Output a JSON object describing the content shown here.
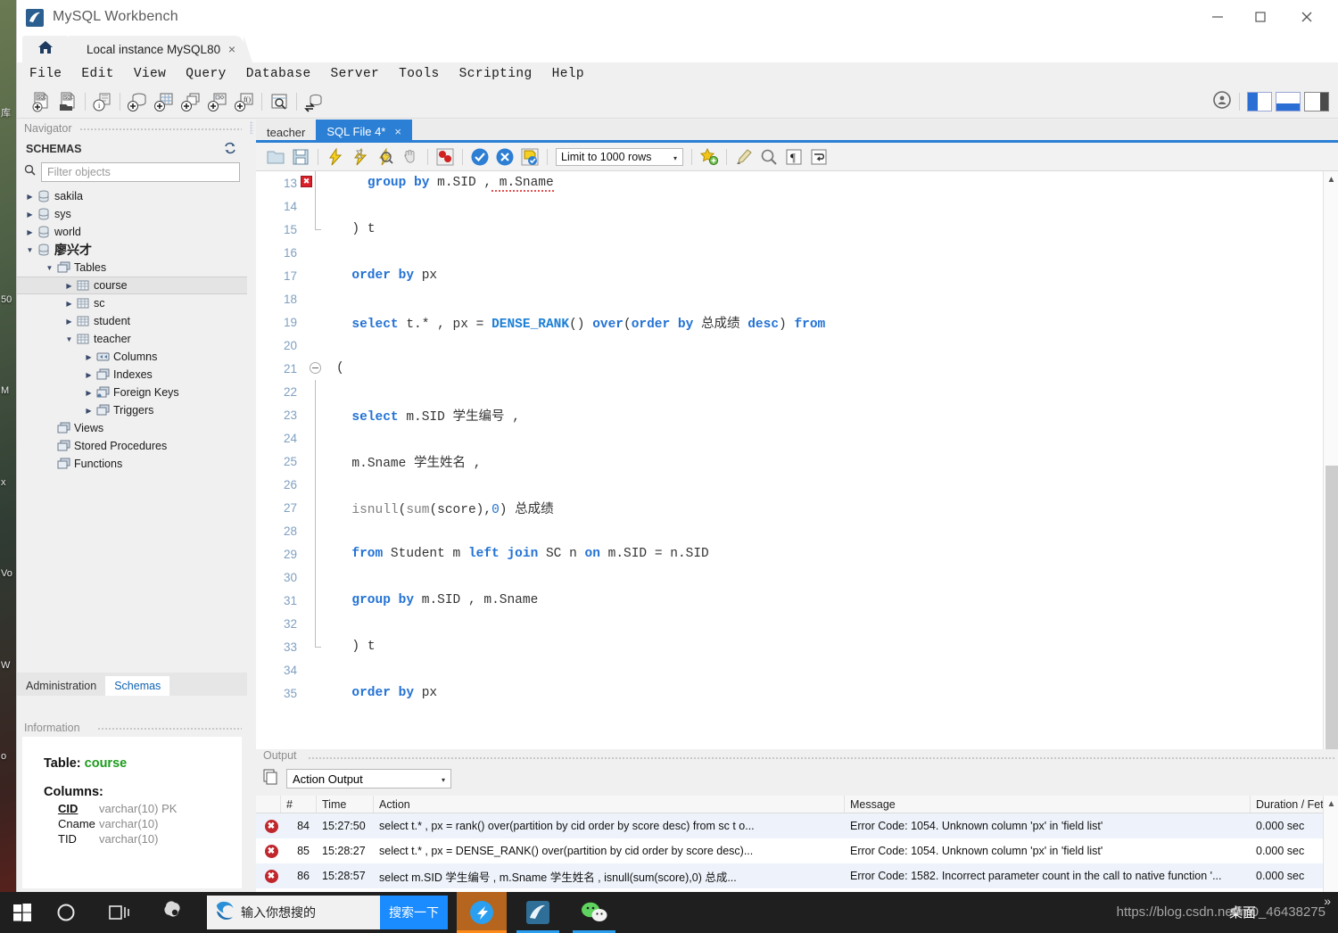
{
  "window": {
    "title": "MySQL Workbench",
    "app_icon": "dolphin-icon",
    "minimize": "minimize-icon",
    "maximize": "maximize-icon",
    "close": "close-icon"
  },
  "tabs": {
    "home_icon": "home-icon",
    "connection_tab": "Local instance MySQL80",
    "connection_tab_close": "×"
  },
  "menubar": {
    "items": [
      "File",
      "Edit",
      "View",
      "Query",
      "Database",
      "Server",
      "Tools",
      "Scripting",
      "Help"
    ]
  },
  "main_toolbar": {
    "icons": [
      "new-sql-tab-icon",
      "open-sql-script-icon",
      "connection-info-icon",
      "new-schema-icon",
      "new-table-icon",
      "new-view-icon",
      "new-stored-procedure-icon",
      "new-function-icon",
      "search-data-icon",
      "reconnect-server-icon"
    ],
    "right_icons": [
      "workbench-badge-icon",
      "toggle-sidebar-icon",
      "toggle-output-icon",
      "toggle-secondary-sidebar-icon"
    ]
  },
  "navigator": {
    "header": "Navigator",
    "schemas_label": "SCHEMAS",
    "refresh_icon": "refresh-icon",
    "search_icon": "search-icon",
    "filter_placeholder": "Filter objects",
    "tree": [
      {
        "label": "sakila",
        "indent": 0,
        "icon": "schema-icon",
        "expanded": false,
        "arrow": "right",
        "selected": false
      },
      {
        "label": "sys",
        "indent": 0,
        "icon": "schema-icon",
        "expanded": false,
        "arrow": "right",
        "selected": false
      },
      {
        "label": "world",
        "indent": 0,
        "icon": "schema-icon",
        "expanded": false,
        "arrow": "right",
        "selected": false
      },
      {
        "label": "廖兴才",
        "indent": 0,
        "icon": "schema-icon",
        "expanded": true,
        "arrow": "down",
        "selected": false,
        "bold": true
      },
      {
        "label": "Tables",
        "indent": 1,
        "icon": "folder-icon",
        "expanded": true,
        "arrow": "down",
        "selected": false
      },
      {
        "label": "course",
        "indent": 2,
        "icon": "table-icon",
        "expanded": false,
        "arrow": "right",
        "selected": true
      },
      {
        "label": "sc",
        "indent": 2,
        "icon": "table-icon",
        "expanded": false,
        "arrow": "right",
        "selected": false
      },
      {
        "label": "student",
        "indent": 2,
        "icon": "table-icon",
        "expanded": false,
        "arrow": "right",
        "selected": false
      },
      {
        "label": "teacher",
        "indent": 2,
        "icon": "table-icon",
        "expanded": true,
        "arrow": "down",
        "selected": false
      },
      {
        "label": "Columns",
        "indent": 3,
        "icon": "columns-icon",
        "expanded": false,
        "arrow": "right",
        "selected": false
      },
      {
        "label": "Indexes",
        "indent": 3,
        "icon": "indexes-icon",
        "expanded": false,
        "arrow": "right",
        "selected": false
      },
      {
        "label": "Foreign Keys",
        "indent": 3,
        "icon": "foreign-keys-icon",
        "expanded": false,
        "arrow": "right",
        "selected": false
      },
      {
        "label": "Triggers",
        "indent": 3,
        "icon": "triggers-icon",
        "expanded": false,
        "arrow": "right",
        "selected": false
      },
      {
        "label": "Views",
        "indent": 1,
        "icon": "views-icon",
        "expanded": false,
        "arrow": "none",
        "selected": false
      },
      {
        "label": "Stored Procedures",
        "indent": 1,
        "icon": "procedures-icon",
        "expanded": false,
        "arrow": "none",
        "selected": false
      },
      {
        "label": "Functions",
        "indent": 1,
        "icon": "functions-icon",
        "expanded": false,
        "arrow": "none",
        "selected": false
      }
    ],
    "bottom_tabs": [
      {
        "label": "Administration",
        "active": false
      },
      {
        "label": "Schemas",
        "active": true
      }
    ]
  },
  "information": {
    "header": "Information",
    "table_label": "Table:",
    "table_name": "course",
    "columns_label": "Columns:",
    "columns": [
      {
        "name": "CID",
        "type": "varchar(10) PK",
        "pk": true
      },
      {
        "name": "Cname",
        "type": "varchar(10)",
        "pk": false
      },
      {
        "name": "TID",
        "type": "varchar(10)",
        "pk": false
      }
    ]
  },
  "editor": {
    "tabs": [
      {
        "label": "teacher",
        "active": false,
        "closable": false
      },
      {
        "label": "SQL File 4*",
        "active": true,
        "closable": true,
        "close": "×"
      }
    ],
    "toolbar": {
      "icons": [
        "open-file-icon",
        "save-file-icon",
        "execute-icon",
        "execute-current-statement-icon",
        "explain-icon",
        "stop-icon",
        "toggle-breakpoint-icon",
        "commit-icon",
        "rollback-icon",
        "autocommit-icon"
      ],
      "limit_label": "Limit to 1000 rows",
      "limit_caret": "▾",
      "right_icons": [
        "add-snippet-icon",
        "beautify-icon",
        "find-icon",
        "show-invisible-icon",
        "wrap-lines-icon"
      ]
    },
    "first_visible_line": 13,
    "lines": [
      {
        "n": 13,
        "error": true,
        "fold": "end",
        "text": "    group by m.SID ,_m.Sname"
      },
      {
        "n": 14,
        "error": false,
        "fold": "bar",
        "text": ""
      },
      {
        "n": 15,
        "error": false,
        "fold": "tail",
        "text": "  ) t"
      },
      {
        "n": 16,
        "error": false,
        "fold": "none",
        "text": ""
      },
      {
        "n": 17,
        "error": false,
        "fold": "none",
        "text": "  order by px"
      },
      {
        "n": 18,
        "error": false,
        "fold": "none",
        "text": ""
      },
      {
        "n": 19,
        "error": false,
        "fold": "none",
        "text": "  select t.* , px = DENSE_RANK() over(order by 总成绩 desc) from"
      },
      {
        "n": 20,
        "error": false,
        "fold": "none",
        "text": ""
      },
      {
        "n": 21,
        "error": false,
        "fold": "start",
        "text": "("
      },
      {
        "n": 22,
        "error": false,
        "fold": "bar",
        "text": ""
      },
      {
        "n": 23,
        "error": false,
        "fold": "bar",
        "text": "  select m.SID 学生编号 ,"
      },
      {
        "n": 24,
        "error": false,
        "fold": "bar",
        "text": ""
      },
      {
        "n": 25,
        "error": false,
        "fold": "bar",
        "text": "  m.Sname 学生姓名 ,"
      },
      {
        "n": 26,
        "error": false,
        "fold": "bar",
        "text": ""
      },
      {
        "n": 27,
        "error": false,
        "fold": "bar",
        "text": "  isnull(sum(score),0) 总成绩"
      },
      {
        "n": 28,
        "error": false,
        "fold": "bar",
        "text": ""
      },
      {
        "n": 29,
        "error": false,
        "fold": "bar",
        "text": "  from Student m left join SC n on m.SID = n.SID"
      },
      {
        "n": 30,
        "error": false,
        "fold": "bar",
        "text": ""
      },
      {
        "n": 31,
        "error": false,
        "fold": "bar",
        "text": "  group by m.SID , m.Sname"
      },
      {
        "n": 32,
        "error": false,
        "fold": "bar",
        "text": ""
      },
      {
        "n": 33,
        "error": false,
        "fold": "tail",
        "text": "  ) t"
      },
      {
        "n": 34,
        "error": false,
        "fold": "none",
        "text": ""
      },
      {
        "n": 35,
        "error": false,
        "fold": "none",
        "text": "  order by px"
      }
    ]
  },
  "output": {
    "header": "Output",
    "copy_icon": "copy-icon",
    "selected_view": "Action Output",
    "caret": "▾",
    "columns": [
      "",
      "#",
      "Time",
      "Action",
      "Message",
      "Duration / Fetch"
    ],
    "rows": [
      {
        "status": "error-icon",
        "num": "84",
        "time": "15:27:50",
        "action": "select t.* , px = rank() over(partition by cid order by score desc) from sc t o...",
        "message": "Error Code: 1054. Unknown column 'px' in 'field list'",
        "duration": "0.000 sec"
      },
      {
        "status": "error-icon",
        "num": "85",
        "time": "15:28:27",
        "action": "select t.* , px = DENSE_RANK() over(partition by cid order by score desc)...",
        "message": "Error Code: 1054. Unknown column 'px' in 'field list'",
        "duration": "0.000 sec"
      },
      {
        "status": "error-icon",
        "num": "86",
        "time": "15:28:57",
        "action": "select m.SID 学生编号 , m.Sname 学生姓名 , isnull(sum(score),0) 总成...",
        "message": "Error Code: 1582. Incorrect parameter count in the call to native function '...",
        "duration": "0.000 sec"
      }
    ]
  },
  "taskbar": {
    "start_icon": "windows-start-icon",
    "cortana_icon": "cortana-circle-icon",
    "taskview_icon": "task-view-icon",
    "app_icons": [
      "sogou-icon",
      "edge-browser-icon",
      "dingtalk-icon",
      "mysql-workbench-icon",
      "wechat-icon"
    ],
    "search_text": "输入你想搜的",
    "search_button": "搜索一下",
    "desktop_label": "桌面",
    "overflow_chevron": "»",
    "watermark": "https://blog.csdn.net/m0_46438275"
  },
  "desktop_icons": [
    "库",
    "50",
    "M",
    "x",
    "Vo",
    "W",
    "o"
  ],
  "colors": {
    "accent": "#2b7fd4",
    "error": "#c0272d",
    "keyword": "#2372d4",
    "taskbar": "#1f1f1f"
  }
}
